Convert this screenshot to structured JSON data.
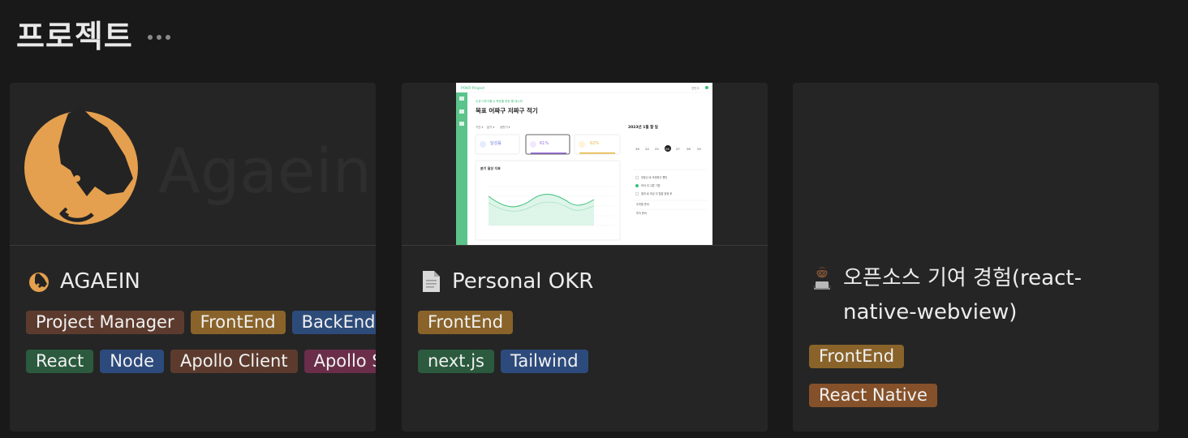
{
  "page": {
    "title": "프로젝트"
  },
  "cards": [
    {
      "title": "AGAEIN",
      "cover_text": "Agaein",
      "tags_row1": [
        "Project Manager",
        "FrontEnd",
        "BackEnd"
      ],
      "tags_row2": [
        "React",
        "Node",
        "Apollo Client",
        "Apollo Server"
      ]
    },
    {
      "title": "Personal OKR",
      "tags_row1": [
        "FrontEnd"
      ],
      "tags_row2": [
        "next.js",
        "Tailwind"
      ],
      "thumbnail": {
        "brand": "POKR Project",
        "user": "권민주",
        "subtitle": "인생 이루기를 & 목표를 위한 웹 레시피",
        "heading": "목표 어짜구 저짜구 적기",
        "filters": [
          "기간 ▾",
          "분기 ▾",
          "상반기 ▾"
        ],
        "calendar_title": "2023년 1월 할 일",
        "week_days": [
          "26",
          "24",
          "25",
          "26",
          "27",
          "28",
          "29"
        ],
        "stat1_value": "달성률",
        "stat2_value": "61%",
        "stat3_value": "62%",
        "chart_title": "분기 달성 지표",
        "tasks": [
          "부동산 로 조정하고 했던",
          "모아 리 고른 기준",
          "줄여 로 조금 다 털밥 정정 후",
          "무엇을 준비",
          "투자 준비"
        ]
      }
    },
    {
      "title": "오픈소스 기여 경험(react-native-webview)",
      "tags_row1": [
        "FrontEnd"
      ],
      "tags_row2": [
        "React Native"
      ]
    }
  ]
}
